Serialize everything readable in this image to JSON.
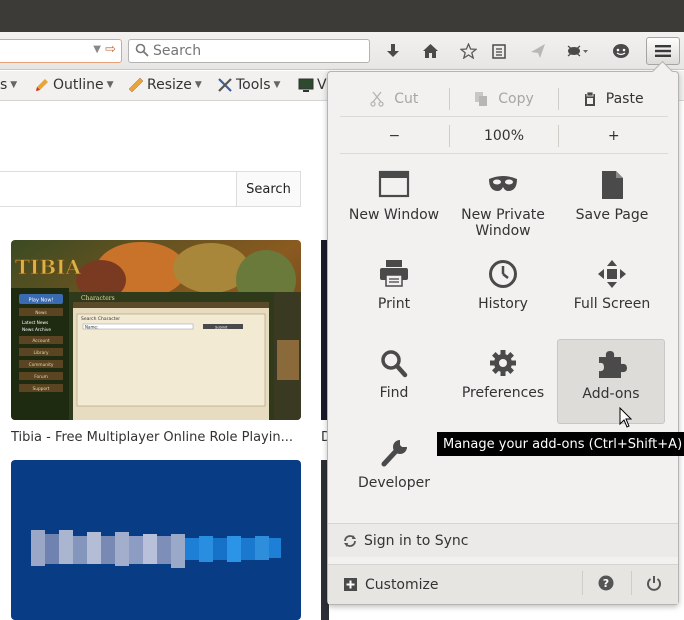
{
  "navbar": {
    "search_placeholder": "Search",
    "icons": [
      "download-icon",
      "home-icon",
      "bookmark-star-icon",
      "reading-list-icon",
      "send-icon",
      "extension-icon",
      "chat-icon",
      "menu-icon"
    ]
  },
  "webdev_toolbar": {
    "items": [
      {
        "label": "s"
      },
      {
        "label": "Outline"
      },
      {
        "label": "Resize"
      },
      {
        "label": "Tools"
      },
      {
        "label": "V"
      }
    ]
  },
  "page": {
    "search_button": "Search",
    "thumbnails": [
      {
        "caption": "Tibia - Free Multiplayer Online Role Playin...",
        "logo": "TIBIA"
      },
      {
        "caption": "D"
      }
    ],
    "tibia_menu": [
      "Play Now!",
      "News",
      "Latest News",
      "News Archive",
      "Account",
      "Library",
      "Community",
      "Forum",
      "Support"
    ],
    "tibia_panel_title": "Characters",
    "tibia_search_title": "Search Character",
    "tibia_name_label": "Name:",
    "tibia_submit": "Submit"
  },
  "menu_panel": {
    "edit": {
      "cut": "Cut",
      "copy": "Copy",
      "paste": "Paste"
    },
    "zoom": {
      "minus": "−",
      "level": "100%",
      "plus": "+"
    },
    "tiles": [
      {
        "label": "New Window",
        "icon": "window-icon"
      },
      {
        "label": "New Private Window",
        "icon": "mask-icon"
      },
      {
        "label": "Save Page",
        "icon": "page-icon"
      },
      {
        "label": "Print",
        "icon": "print-icon"
      },
      {
        "label": "History",
        "icon": "clock-icon"
      },
      {
        "label": "Full Screen",
        "icon": "fullscreen-icon"
      },
      {
        "label": "Find",
        "icon": "magnifier-icon"
      },
      {
        "label": "Preferences",
        "icon": "gear-icon"
      },
      {
        "label": "Add-ons",
        "icon": "puzzle-icon"
      },
      {
        "label": "Developer",
        "icon": "wrench-icon"
      }
    ],
    "sync": "Sign in to Sync",
    "customize": "Customize"
  },
  "tooltip": "Manage your add-ons (Ctrl+Shift+A)",
  "colors": {
    "titlebar": "#3c3b37",
    "panel": "#f2f1f0",
    "accent": "#e8a27a",
    "tibia_blue": "#083c84"
  }
}
